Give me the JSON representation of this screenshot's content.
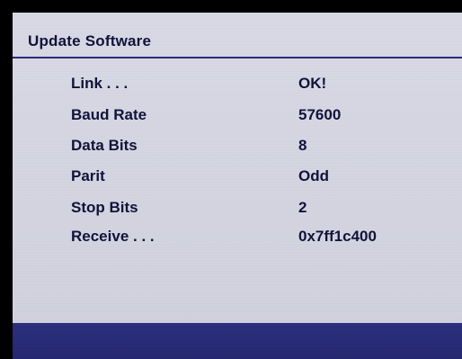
{
  "dialog": {
    "title": "Update Software"
  },
  "rows": [
    {
      "label": "Link . . .",
      "value": "OK!"
    },
    {
      "label": "Baud Rate",
      "value": "57600"
    },
    {
      "label": "Data Bits",
      "value": "8"
    },
    {
      "label": "Parit",
      "value": "Odd"
    },
    {
      "label": "Stop Bits",
      "value": "2"
    },
    {
      "label": "Receive . . .",
      "value": "0x7ff1c400"
    }
  ],
  "colors": {
    "panel_background": "#d6d7e2",
    "text": "#12123a",
    "rule": "#2a2a7a",
    "bottom_bar": "#2a2d78",
    "border": "#000000"
  }
}
